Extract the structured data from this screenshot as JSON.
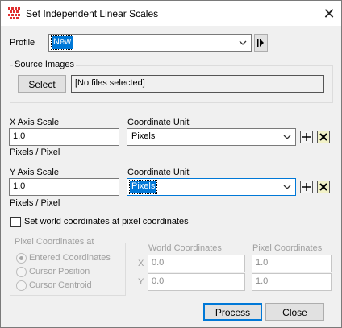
{
  "window": {
    "title": "Set Independent Linear Scales",
    "close_glyph": "✕"
  },
  "profile": {
    "label": "Profile",
    "value": "New"
  },
  "source": {
    "group_title": "Source Images",
    "select_label": "Select",
    "files_text": "[No files selected]"
  },
  "x_axis": {
    "scale_label": "X Axis Scale",
    "scale_value": "1.0",
    "units_text": "Pixels / Pixel",
    "coord_unit_label": "Coordinate Unit",
    "coord_unit_value": "Pixels"
  },
  "y_axis": {
    "scale_label": "Y Axis Scale",
    "scale_value": "1.0",
    "units_text": "Pixels / Pixel",
    "coord_unit_label": "Coordinate Unit",
    "coord_unit_value": "Pixels"
  },
  "world_checkbox": {
    "label": "Set world coordinates at pixel coordinates",
    "checked": false
  },
  "pixel_coords": {
    "group_title": "Pixel Coordinates at",
    "options": [
      "Entered Coordinates",
      "Cursor Position",
      "Cursor Centroid"
    ],
    "selected": "Entered Coordinates"
  },
  "coords": {
    "world_header": "World Coordinates",
    "pixel_header": "Pixel Coordinates",
    "x_label": "X",
    "y_label": "Y",
    "world_x": "0.0",
    "world_y": "0.0",
    "pixel_x": "1.0",
    "pixel_y": "1.0"
  },
  "buttons": {
    "process": "Process",
    "close": "Close"
  },
  "colors": {
    "accent": "#0078d7",
    "app_icon": "#e03030"
  }
}
